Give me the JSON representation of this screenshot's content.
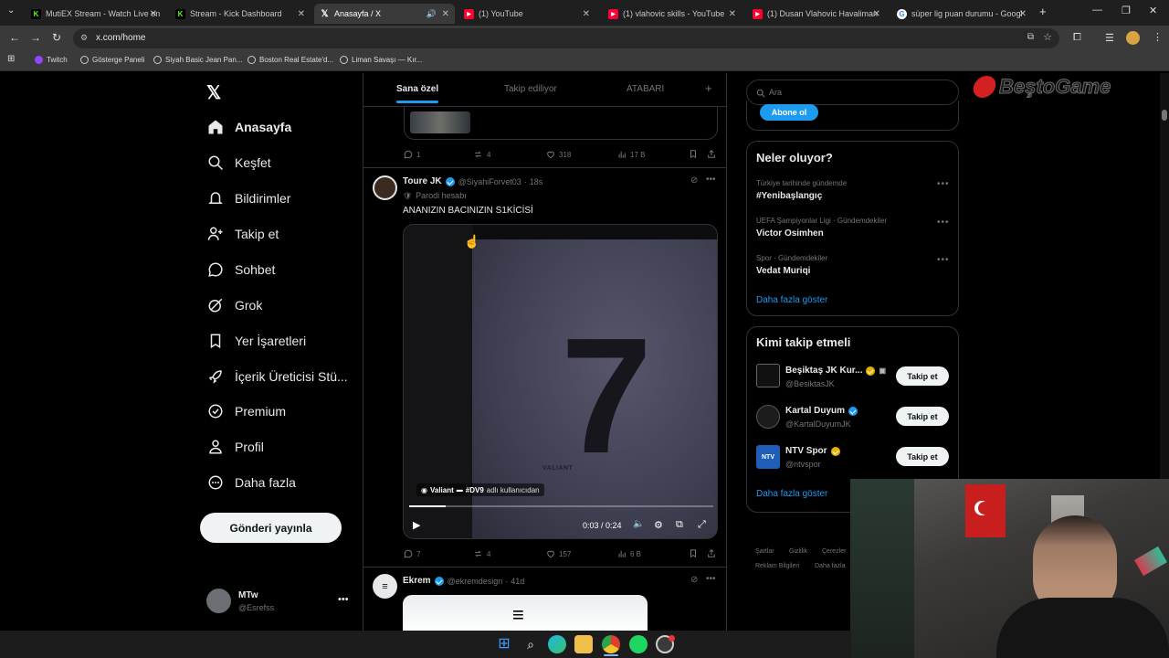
{
  "browser": {
    "tabs": [
      {
        "title": "MutiEX Stream - Watch Live on",
        "favicon_color": "#53fc18"
      },
      {
        "title": "Stream - Kick Dashboard",
        "favicon_color": "#53fc18"
      },
      {
        "title": "Anasayfa / X",
        "favicon_color": "#ffffff",
        "active": true
      },
      {
        "title": "(1) YouTube",
        "favicon_color": "#ff0033"
      },
      {
        "title": "(1) vlahovic skills - YouTube",
        "favicon_color": "#ff0033"
      },
      {
        "title": "(1) Dusan Vlahovic Havaliman",
        "favicon_color": "#ff0033"
      },
      {
        "title": "süper lig puan durumu - Googl",
        "favicon_color": "#4285f4"
      }
    ],
    "url": "x.com/home",
    "bookmarks": [
      "Twitch",
      "Gösterge Paneli",
      "Siyah Basic Jean Pan...",
      "Boston Real Estate'd...",
      "Liman Savaşı — Kır..."
    ]
  },
  "sidebar": {
    "items": [
      {
        "label": "Anasayfa",
        "icon": "home-icon"
      },
      {
        "label": "Keşfet",
        "icon": "search-icon"
      },
      {
        "label": "Bildirimler",
        "icon": "bell-icon"
      },
      {
        "label": "Takip et",
        "icon": "add-person-icon"
      },
      {
        "label": "Sohbet",
        "icon": "chat-icon"
      },
      {
        "label": "Grok",
        "icon": "grok-icon"
      },
      {
        "label": "Yer İşaretleri",
        "icon": "bookmark-icon"
      },
      {
        "label": "İçerik Üreticisi Stü...",
        "icon": "rocket-icon"
      },
      {
        "label": "Premium",
        "icon": "verified-icon"
      },
      {
        "label": "Profil",
        "icon": "person-icon"
      },
      {
        "label": "Daha fazla",
        "icon": "more-circle-icon"
      }
    ],
    "post_button": "Gönderi yayınla",
    "account": {
      "name": "MTw",
      "handle": "@Esrefss"
    }
  },
  "feed": {
    "tabs": [
      "Sana özel",
      "Takip ediliyor",
      "ATABARI"
    ],
    "prev_post_actions": {
      "replies": "1",
      "reposts": "4",
      "likes": "318",
      "views": "17 B"
    },
    "post": {
      "author": "Toure JK",
      "handle": "@SiyahiForvet03",
      "time": "18s",
      "label": "Parodi hesabı",
      "text": "ANANIZIN BACINIZIN S1KİCİSİ",
      "video_overlay": "Valiant",
      "video_tag": "#DV9",
      "video_tag_suffix": "adlı kullanıcıdan",
      "video_time": "0:03 / 0:24",
      "video_progress": 0.12,
      "jersey_number": "7",
      "jersey_brand": "VALIANT",
      "actions": {
        "replies": "7",
        "reposts": "4",
        "likes": "157",
        "views": "6 B"
      }
    },
    "next_post": {
      "author": "Ekrem",
      "handle": "@ekremdesign",
      "time": "41d"
    }
  },
  "right": {
    "search_placeholder": "Ara",
    "subscribe_button": "Abone ol",
    "trends_title": "Neler oluyor?",
    "trends": [
      {
        "category": "Türkiye tarihinde gündemde",
        "name": "#Yenibaşlangıç"
      },
      {
        "category": "UEFA Şampiyonlar Ligi · Gündemdekiler",
        "name": "Victor Osimhen"
      },
      {
        "category": "Spor · Gündemdekiler",
        "name": "Vedat Muriqi"
      }
    ],
    "show_more": "Daha fazla göster",
    "who_to_follow_title": "Kimi takip etmeli",
    "follow": [
      {
        "name": "Beşiktaş JK Kur...",
        "handle": "@BesiktasJK",
        "badge": "gold"
      },
      {
        "name": "Kartal Duyum",
        "handle": "@KartalDuyumJK",
        "badge": "blue"
      },
      {
        "name": "NTV Spor",
        "handle": "@ntvspor",
        "badge": "gold"
      }
    ],
    "follow_button": "Takip et",
    "show_more_2": "Daha fazla göster",
    "footer_links": [
      "Şartlar",
      "Gizlilik",
      "Çerezler",
      "Reklam Bilgileri",
      "Daha fazla"
    ]
  },
  "overlay": {
    "brand": "BeştoGame"
  },
  "colors": {
    "accent": "#1d9bf0",
    "background": "#000000",
    "border": "#2f3336",
    "muted": "#71767b"
  }
}
